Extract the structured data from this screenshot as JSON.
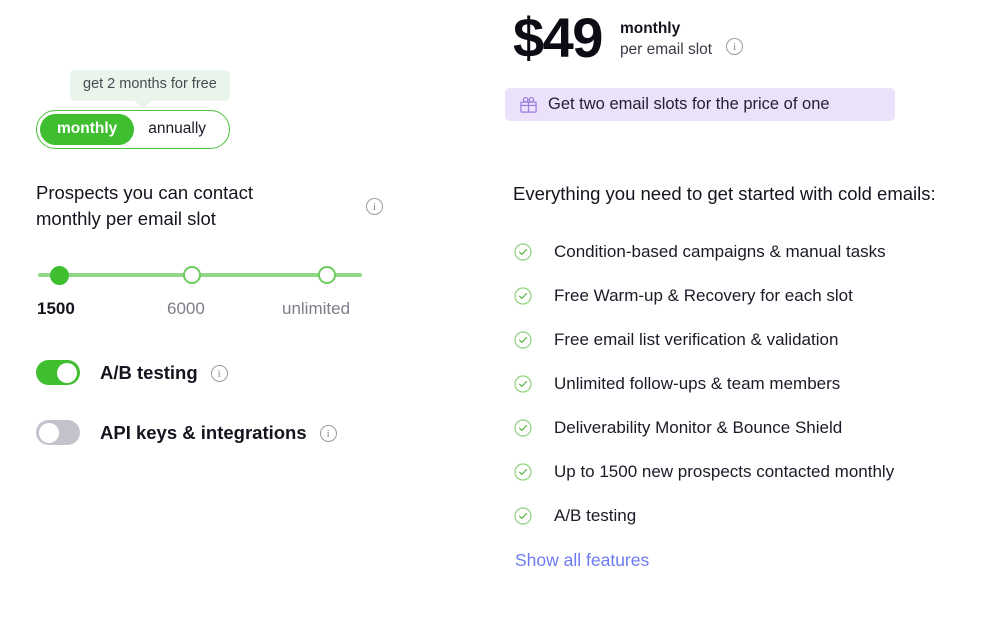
{
  "plan": {
    "currency_symbol": "$",
    "price": "49",
    "price_display": "$49",
    "period": "monthly",
    "unit": "per email slot",
    "price_info_icon": "info-icon"
  },
  "billing": {
    "promo_bubble": "get 2 months for free",
    "options": [
      {
        "label": "monthly",
        "selected": true
      },
      {
        "label": "annually",
        "selected": false
      }
    ]
  },
  "promo_banner": {
    "icon": "gift-icon",
    "text": "Get two email slots for the price of one",
    "background": "#ebe1fb",
    "icon_color": "#9b7fe0"
  },
  "prospects": {
    "title": "Prospects you can contact monthly per email slot",
    "title_line1": "Prospects you can contact",
    "title_line2": "monthly per email slot",
    "info_icon": "info-icon",
    "slider": {
      "steps": [
        {
          "label": "1500",
          "selected": true
        },
        {
          "label": "6000",
          "selected": false
        },
        {
          "label": "unlimited",
          "selected": false
        }
      ],
      "selected_index": 0,
      "track_color": "#8fd787",
      "active_color": "#3fbf30"
    }
  },
  "switches": [
    {
      "label": "A/B testing",
      "on": true,
      "info_icon": "info-icon"
    },
    {
      "label": "API keys & integrations",
      "on": false,
      "info_icon": "info-icon"
    }
  ],
  "features": {
    "heading": "Everything you need to get started with cold emails:",
    "items": [
      {
        "label": "Condition-based campaigns & manual tasks"
      },
      {
        "label": "Free Warm-up & Recovery for each slot"
      },
      {
        "label": "Free email list verification & validation"
      },
      {
        "label": "Unlimited follow-ups & team members"
      },
      {
        "label": "Deliverability Monitor & Bounce Shield"
      },
      {
        "label": "Up to 1500 new prospects contacted monthly"
      },
      {
        "label": "A/B testing"
      }
    ],
    "show_all_label": "Show all features",
    "show_all_color": "#6c7bf0",
    "check_color": "#7dc96f"
  },
  "colors": {
    "brand_green": "#3fbf30",
    "track_green": "#8fd787",
    "bubble_green": "#e9f5ea",
    "promo_purple": "#ebe1fb",
    "link_indigo": "#6c7bf0",
    "switch_off_gray": "#c3c3cb"
  }
}
